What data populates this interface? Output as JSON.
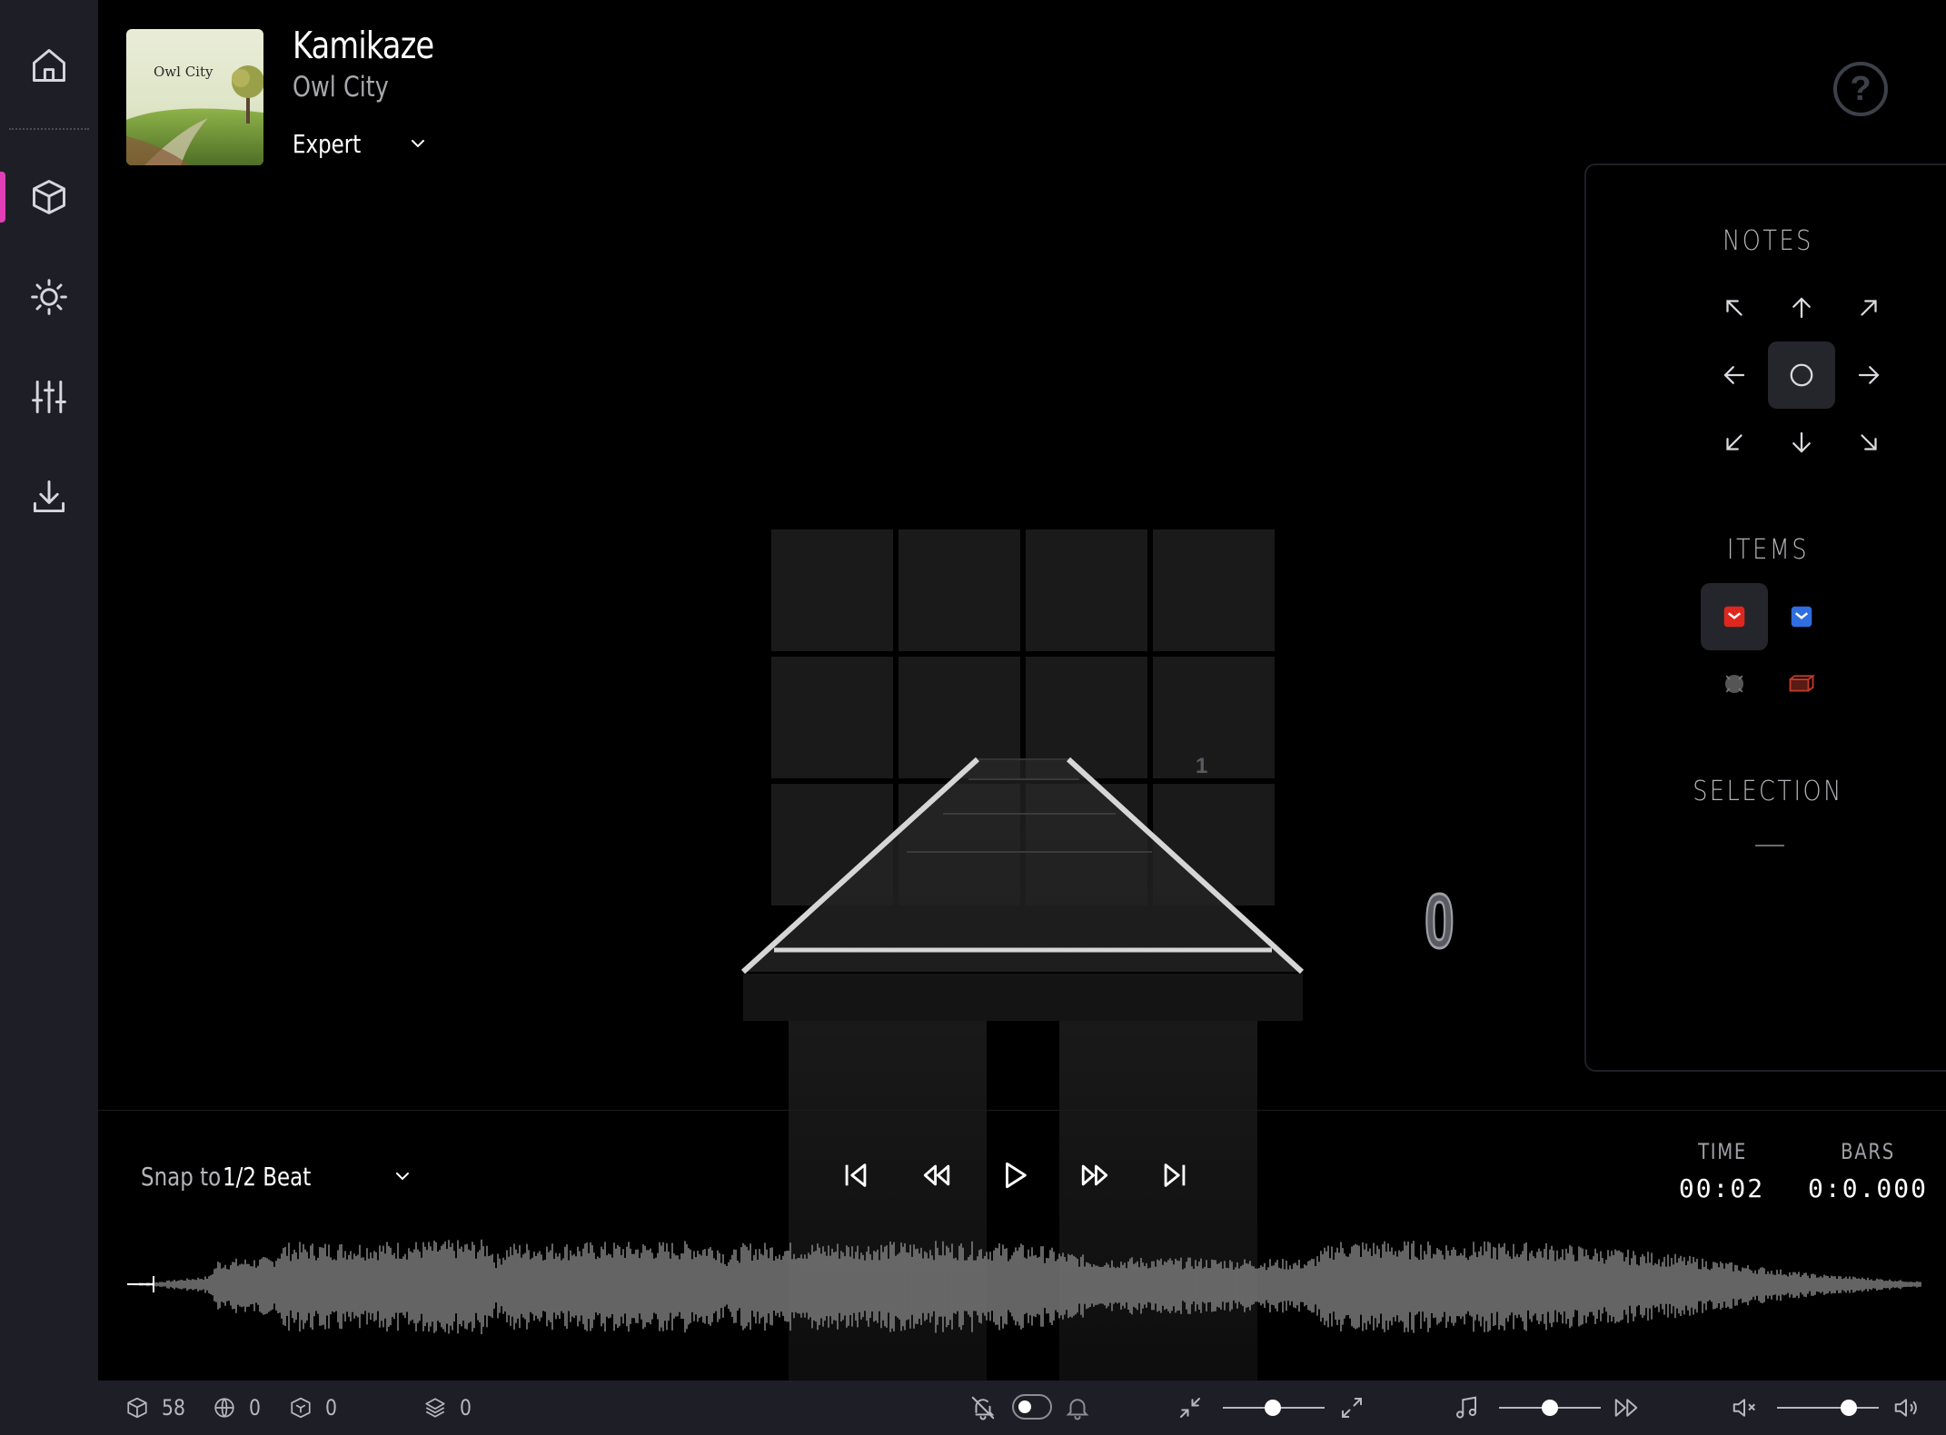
{
  "sidebar": {
    "items": [
      {
        "name": "home",
        "icon": "home-icon"
      },
      {
        "name": "notes",
        "icon": "cube-icon",
        "active": true
      },
      {
        "name": "lighting",
        "icon": "sun-icon"
      },
      {
        "name": "settings",
        "icon": "sliders-icon"
      },
      {
        "name": "download",
        "icon": "download-icon"
      }
    ]
  },
  "song": {
    "title": "Kamikaze",
    "artist": "Owl City",
    "difficulty": "Expert",
    "cover_text": "Owl City"
  },
  "panel": {
    "notes_title": "NOTES",
    "items_title": "ITEMS",
    "selection_title": "SELECTION",
    "selection_value": "",
    "notes_directions": [
      "up-left",
      "up",
      "up-right",
      "left",
      "any",
      "right",
      "down-left",
      "down",
      "down-right"
    ],
    "selected_direction": "any",
    "items": [
      {
        "name": "red-block",
        "color": "#e0271d",
        "selected": true
      },
      {
        "name": "blue-block",
        "color": "#2f6ee0"
      },
      {
        "name": "bomb",
        "color": "#555555"
      },
      {
        "name": "obstacle",
        "color": "#c23a2a"
      }
    ]
  },
  "stage": {
    "beat_marker": "1",
    "current_beat": "0"
  },
  "playback": {
    "snap_label": "Snap to",
    "snap_value": "1/2 Beat",
    "time_label": "TIME",
    "time_value": "00:02",
    "bars_label": "BARS",
    "bars_value": "0:0.000",
    "controls": [
      "skip-to-start",
      "rewind",
      "play",
      "fast-forward",
      "skip-to-end"
    ]
  },
  "status": {
    "notes_count": "58",
    "globe_count": "0",
    "obstacles_count": "0",
    "layers_count": "0",
    "accent_color": "#e23fb6"
  }
}
